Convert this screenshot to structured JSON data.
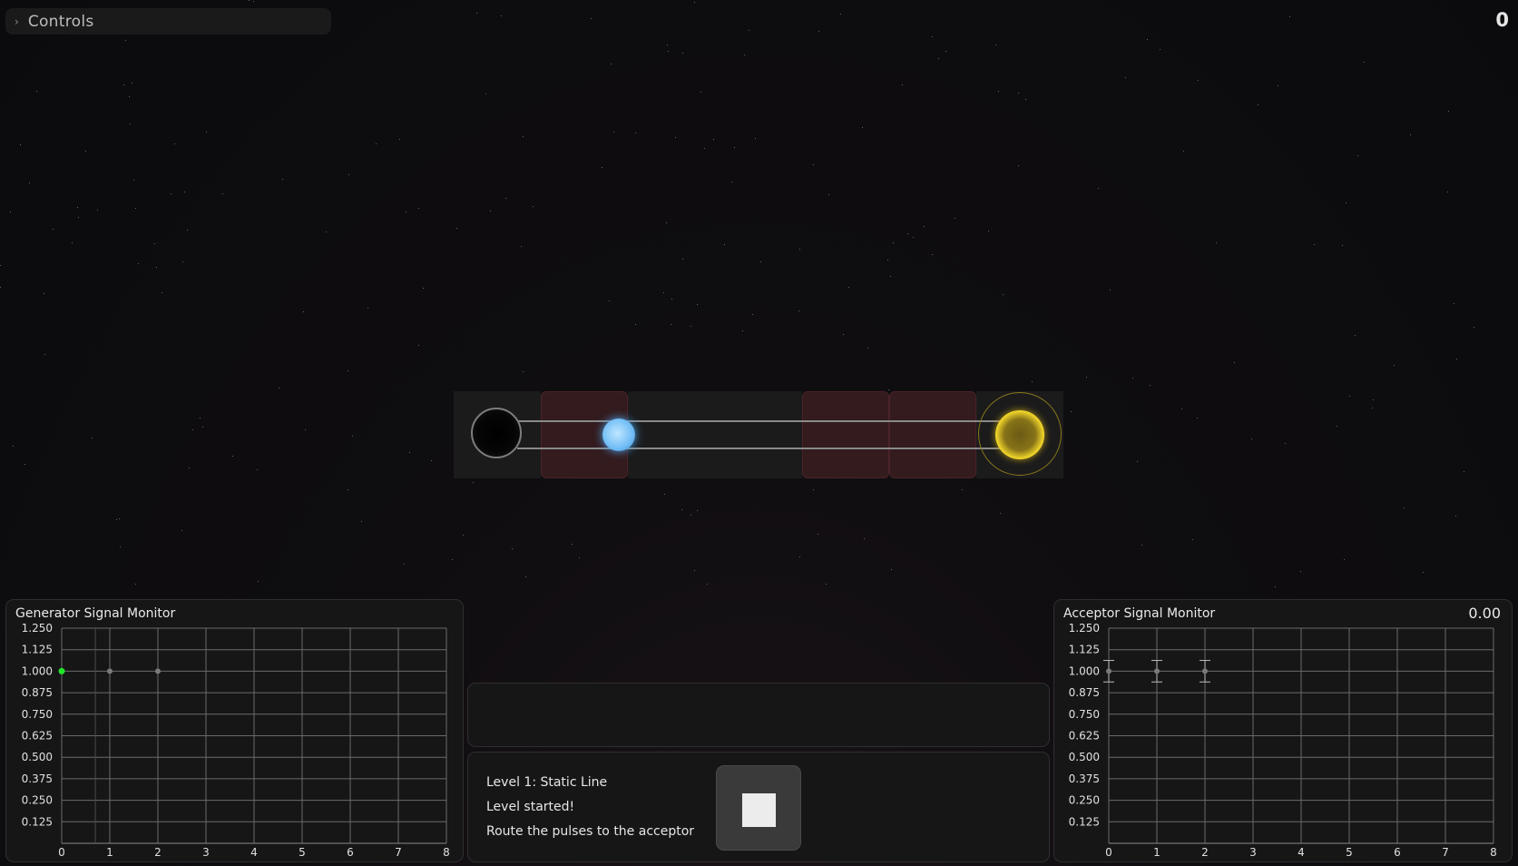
{
  "controls": {
    "label": "Controls"
  },
  "score": "0",
  "colors": {
    "generator_point": "#22e52a",
    "pulse": "#77c1f7",
    "acceptor": "#f6db2b",
    "hazard": "#331b1e"
  },
  "info": {
    "level": "Level 1: Static Line",
    "status": "Level started!",
    "hint": "Route the pulses to the acceptor"
  },
  "generator_monitor": {
    "title": "Generator Signal Monitor"
  },
  "acceptor_monitor": {
    "title": "Acceptor Signal Monitor",
    "value": "0.00"
  },
  "chart_data": [
    {
      "type": "scatter",
      "title": "Generator Signal Monitor",
      "x_ticks": [
        "0",
        "1",
        "2",
        "3",
        "4",
        "5",
        "6",
        "7",
        "8"
      ],
      "y_ticks": [
        "1.250",
        "1.125",
        "1.000",
        "0.875",
        "0.750",
        "0.625",
        "0.500",
        "0.375",
        "0.250",
        "0.125"
      ],
      "xlim": [
        0,
        8
      ],
      "ylim": [
        0,
        1.25
      ],
      "grid": true,
      "series": [
        {
          "x": [
            0,
            1,
            2
          ],
          "y": [
            1.0,
            1.0,
            1.0
          ],
          "highlight_index": 0
        }
      ],
      "cursor_x": 0.7
    },
    {
      "type": "scatter",
      "title": "Acceptor Signal Monitor",
      "x_ticks": [
        "0",
        "1",
        "2",
        "3",
        "4",
        "5",
        "6",
        "7",
        "8"
      ],
      "y_ticks": [
        "1.250",
        "1.125",
        "1.000",
        "0.875",
        "0.750",
        "0.625",
        "0.500",
        "0.375",
        "0.250",
        "0.125"
      ],
      "xlim": [
        0,
        8
      ],
      "ylim": [
        0,
        1.25
      ],
      "grid": true,
      "series": [
        {
          "x": [
            0,
            1,
            2
          ],
          "y": [
            1.0,
            1.0,
            1.0
          ],
          "error": 0.0625
        }
      ]
    }
  ]
}
